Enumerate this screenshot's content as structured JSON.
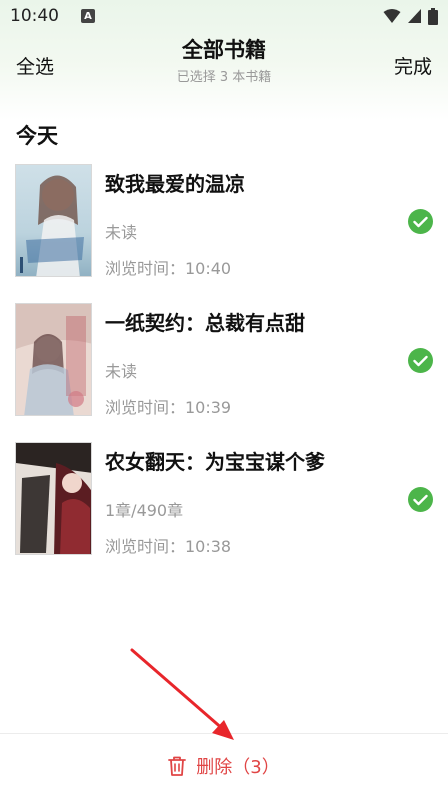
{
  "status_bar": {
    "time": "10:40",
    "notification_letter": "A"
  },
  "header": {
    "select_all_label": "全选",
    "title": "全部书籍",
    "subtitle": "已选择 3 本书籍",
    "done_label": "完成"
  },
  "section": {
    "title": "今天"
  },
  "books": [
    {
      "title": "致我最爱的温凉",
      "progress": "未读",
      "time": "浏览时间：10:40",
      "selected": true
    },
    {
      "title": "一纸契约：总裁有点甜",
      "progress": "未读",
      "time": "浏览时间：10:39",
      "selected": true
    },
    {
      "title": "农女翻天：为宝宝谋个爹",
      "progress": "1章/490章",
      "time": "浏览时间：10:38",
      "selected": true
    }
  ],
  "bottom_bar": {
    "delete_label": "删除（3）",
    "icon": "trash-icon"
  },
  "colors": {
    "accent_green": "#4cb54a",
    "delete_red": "#e04545"
  }
}
